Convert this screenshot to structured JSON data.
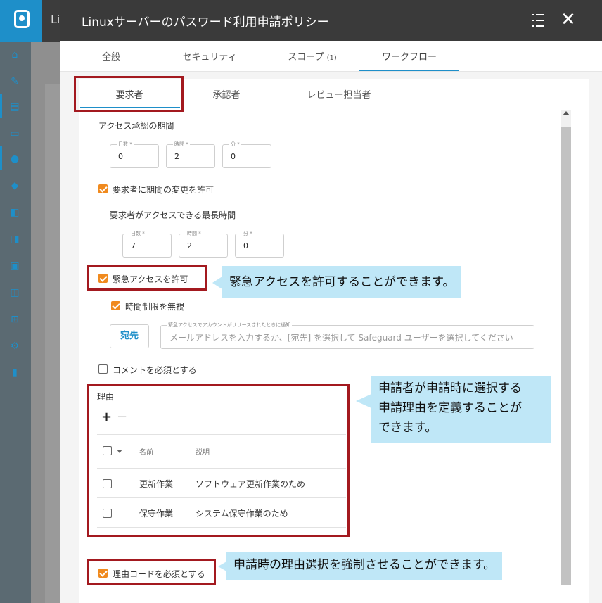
{
  "background": {
    "app_title_fragment": "Li"
  },
  "dialog": {
    "title": "Linuxサーバーのパスワード利用申請ポリシー",
    "close_glyph": "✕"
  },
  "tabs": {
    "general": "全般",
    "security": "セキュリティ",
    "scope": "スコープ",
    "scope_count": "(1)",
    "workflow": "ワークフロー"
  },
  "sub_tabs": {
    "requester": "要求者",
    "approver": "承認者",
    "reviewer": "レビュー担当者"
  },
  "access_duration": {
    "title": "アクセス承認の期間",
    "days_caption": "日数 *",
    "days": "0",
    "hours_caption": "時間 *",
    "hours": "2",
    "minutes_caption": "分 *",
    "minutes": "0"
  },
  "allow_change": {
    "label": "要求者に期間の変更を許可",
    "checked": true
  },
  "max_duration": {
    "title": "要求者がアクセスできる最長時間",
    "days_caption": "日数 *",
    "days": "7",
    "hours_caption": "時間 *",
    "hours": "2",
    "minutes_caption": "分 *",
    "minutes": "0"
  },
  "emergency": {
    "label": "緊急アクセスを許可",
    "checked": true,
    "ignore_time_label": "時間制限を無視",
    "ignore_time_checked": true,
    "to_button": "宛先",
    "notify_caption": "緊急アクセスでアカウントがリリースされたときに通知",
    "email_placeholder": "メールアドレスを入力するか、[宛先] を選択して Safeguard ユーザーを選択してください"
  },
  "require_comment": {
    "label": "コメントを必須とする",
    "checked": false
  },
  "reasons": {
    "title": "理由",
    "add_glyph": "+",
    "remove_glyph": "−",
    "col_name": "名前",
    "col_description": "説明",
    "rows": [
      {
        "name": "更新作業",
        "description": "ソフトウェア更新作業のため"
      },
      {
        "name": "保守作業",
        "description": "システム保守作業のため"
      }
    ]
  },
  "require_reason_code": {
    "label": "理由コードを必須とする",
    "checked": true
  },
  "callouts": {
    "emergency": "緊急アクセスを許可することができます。",
    "reasons_line1": "申請者が申請時に選択する",
    "reasons_line2": "申請理由を定義することが",
    "reasons_line3": "できます。",
    "reason_code": "申請時の理由選択を強制させることができます。"
  },
  "colors": {
    "accent": "#1e8fc9",
    "checkbox": "#f08a1e",
    "annotation_border": "#a3191f",
    "callout_bg": "#bfe7f7",
    "header_bg": "#3a3a3a"
  }
}
